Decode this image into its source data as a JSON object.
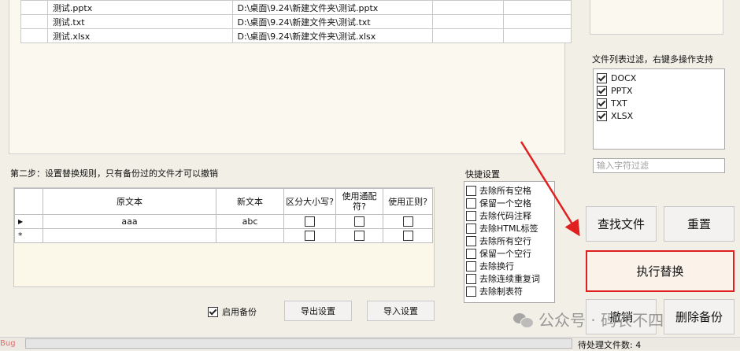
{
  "files": [
    {
      "name": "测试.pptx",
      "path": "D:\\桌面\\9.24\\新建文件夹\\测试.pptx"
    },
    {
      "name": "测试.txt",
      "path": "D:\\桌面\\9.24\\新建文件夹\\测试.txt"
    },
    {
      "name": "测试.xlsx",
      "path": "D:\\桌面\\9.24\\新建文件夹\\测试.xlsx"
    }
  ],
  "step2_label": "第二步：设置替换规则，只有备份过的文件才可以撤销",
  "rules": {
    "headers": {
      "original": "原文本",
      "new": "新文本",
      "case": "区分大小写?",
      "wildcard": "使用通配符?",
      "regex": "使用正则?"
    },
    "rows": [
      {
        "marker": "▶",
        "original": "aaa",
        "new": "abc"
      },
      {
        "marker": "*",
        "original": "",
        "new": ""
      }
    ]
  },
  "quick": {
    "title": "快捷设置",
    "items": [
      "去除所有空格",
      "保留一个空格",
      "去除代码注释",
      "去除HTML标签",
      "去除所有空行",
      "保留一个空行",
      "去除换行",
      "去除连续重复词",
      "去除制表符"
    ]
  },
  "filter": {
    "title": "文件列表过滤，右键多操作支持",
    "items": [
      "DOCX",
      "PPTX",
      "TXT",
      "XLSX"
    ],
    "placeholder": "输入字符过滤"
  },
  "buttons": {
    "find": "查找文件",
    "reset": "重置",
    "execute": "执行替换",
    "undo": "撤销",
    "delete_backup": "删除备份",
    "export": "导出设置",
    "import": "导入设置"
  },
  "backup_label": "启用备份",
  "status": {
    "bug": "Bug",
    "pending": "待处理文件数: 4"
  },
  "watermark": "公众号 · 码农不四",
  "colors": {
    "highlight": "#e02020"
  }
}
